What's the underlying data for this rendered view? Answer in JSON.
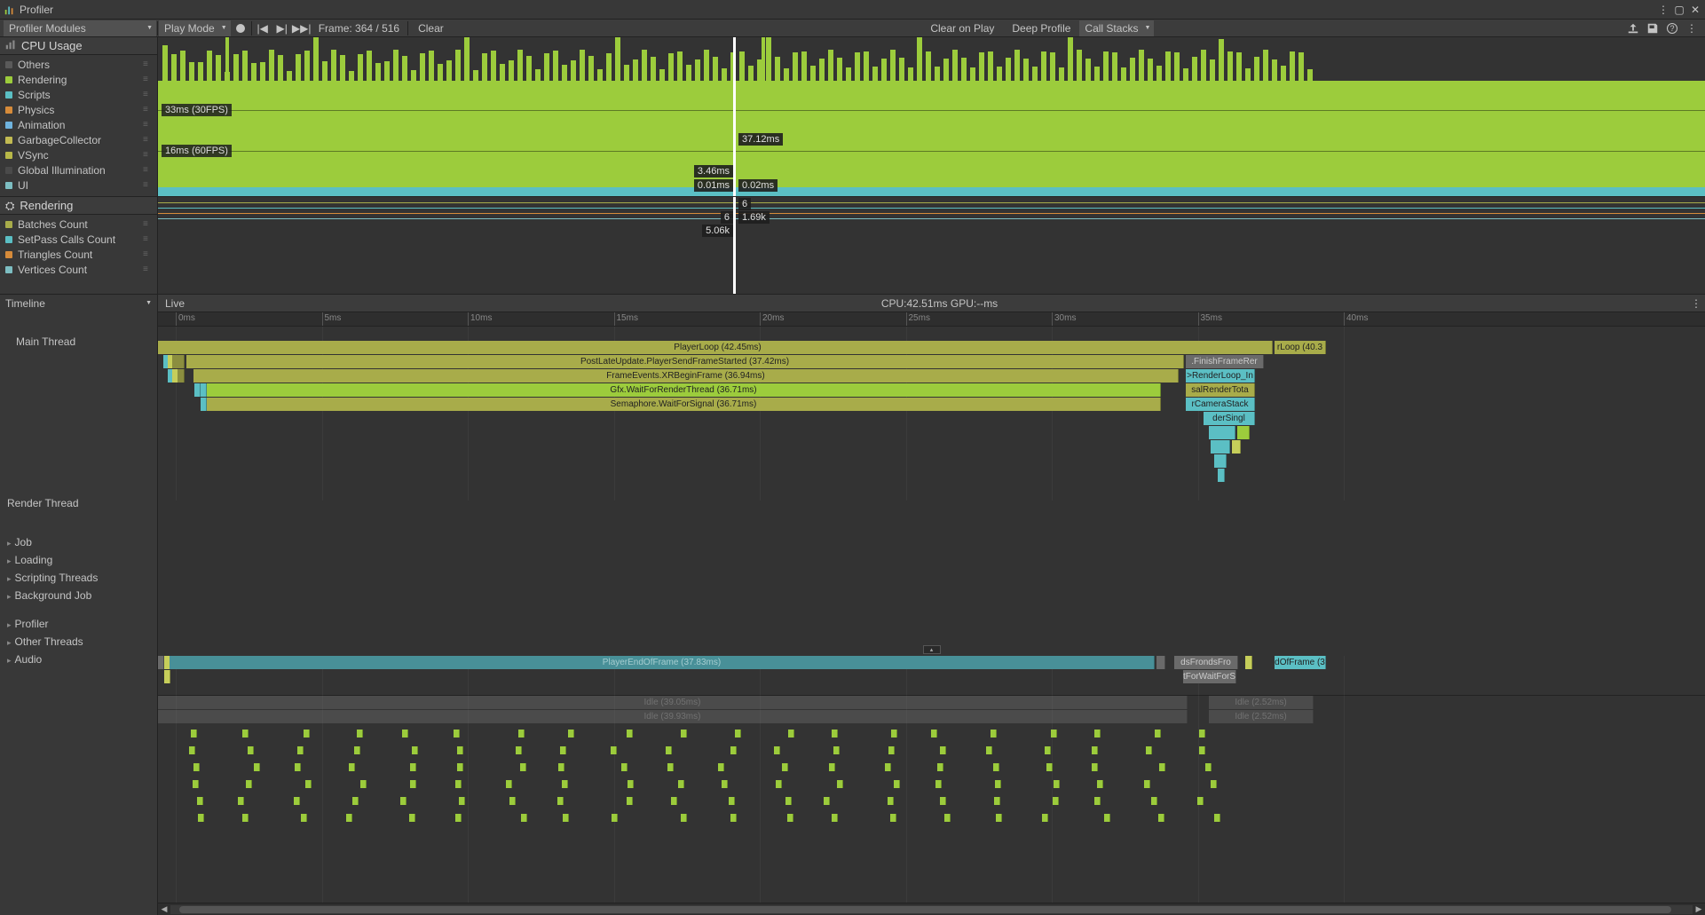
{
  "window": {
    "title": "Profiler"
  },
  "toolbar": {
    "modules_dropdown": "Profiler Modules",
    "play_mode": "Play Mode",
    "frame_info": "Frame: 364 / 516",
    "clear": "Clear",
    "clear_on_play": "Clear on Play",
    "deep_profile": "Deep Profile",
    "call_stacks": "Call Stacks"
  },
  "cpu": {
    "title": "CPU Usage",
    "legend": [
      {
        "label": "Others",
        "color": "#5a5a5a"
      },
      {
        "label": "Rendering",
        "color": "#9ccc3c"
      },
      {
        "label": "Scripts",
        "color": "#5bbfc4"
      },
      {
        "label": "Physics",
        "color": "#d68b3a"
      },
      {
        "label": "Animation",
        "color": "#6fb3de"
      },
      {
        "label": "GarbageCollector",
        "color": "#c2bb52"
      },
      {
        "label": "VSync",
        "color": "#b8b848"
      },
      {
        "label": "Global Illumination",
        "color": "#4a4a4a"
      },
      {
        "label": "UI",
        "color": "#7dbec2"
      }
    ],
    "lines": {
      "top": "33ms (30FPS)",
      "bottom": "16ms (60FPS)"
    },
    "hover": {
      "right_top": "37.12ms",
      "right_bottom": "0.02ms",
      "left_top": "3.46ms",
      "left_bottom": "0.01ms"
    }
  },
  "rendering": {
    "title": "Rendering",
    "legend": [
      {
        "label": "Batches Count",
        "color": "#a8ac4a"
      },
      {
        "label": "SetPass Calls Count",
        "color": "#5bbfc4"
      },
      {
        "label": "Triangles Count",
        "color": "#d68b3a"
      },
      {
        "label": "Vertices Count",
        "color": "#7dbec2"
      }
    ],
    "values": {
      "r1r": "6",
      "r2l": "6",
      "r2r": "1.69k",
      "r3l": "5.06k"
    }
  },
  "timeline": {
    "dropdown": "Timeline",
    "live": "Live",
    "status": "CPU:42.51ms   GPU:--ms",
    "threads": {
      "main": "Main Thread",
      "render": "Render Thread",
      "others": [
        "Job",
        "Loading",
        "Scripting Threads",
        "Background Job",
        "Profiler",
        "Other Threads",
        "Audio"
      ]
    },
    "ruler": [
      "0ms",
      "5ms",
      "10ms",
      "15ms",
      "20ms",
      "25ms",
      "30ms",
      "35ms",
      "40ms"
    ],
    "main_bars": [
      {
        "label": "PlayerLoop (42.45ms)"
      },
      {
        "label": "PostLateUpdate.PlayerSendFrameStarted (37.42ms)"
      },
      {
        "label": "FrameEvents.XRBeginFrame (36.94ms)"
      },
      {
        "label": "Gfx.WaitForRenderThread (36.71ms)"
      },
      {
        "label": "Semaphore.WaitForSignal (36.71ms)"
      }
    ],
    "render_bar": "PlayerEndOfFrame (37.83ms)",
    "render_frag_a": "dsFrondsFro",
    "render_frag_b": "tForWaitForS",
    "render_frag_c": "dOfFrame (3",
    "right_frags": [
      ".FinishFrameRer",
      ">RenderLoop_In",
      "salRenderTota",
      "rCameraStack",
      "derSingl"
    ],
    "idle_bars": [
      "Idle (39.05ms)",
      "Idle (39.93ms)"
    ],
    "idle_frags": [
      "Idle (2.52ms)",
      "Idle (2.52ms)"
    ],
    "mt_right": "rLoop (40.3"
  },
  "chart_data": {
    "type": "area",
    "title": "CPU Usage",
    "xlabel": "Frame",
    "ylabel": "ms",
    "ylim": [
      0,
      50
    ],
    "reference_lines": [
      16,
      33
    ],
    "selected_ms": 37.12,
    "series": [
      {
        "name": "Rendering",
        "color": "#9ccc3c",
        "approx_avg_ms": 28
      },
      {
        "name": "Scripts",
        "color": "#5bbfc4",
        "approx_avg_ms": 3.5
      }
    ],
    "x_selected": 364,
    "x_total": 516
  }
}
